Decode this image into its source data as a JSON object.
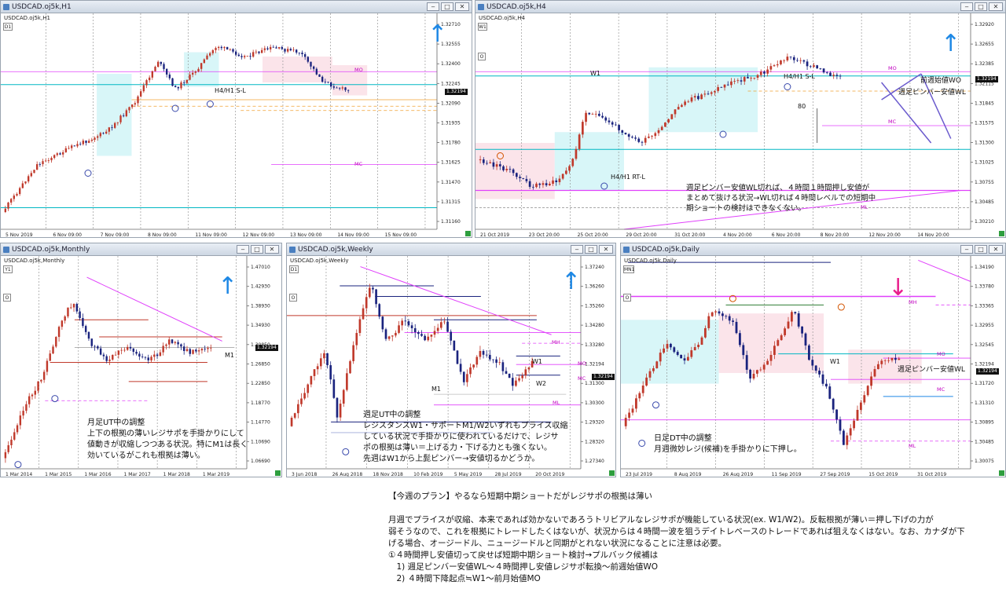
{
  "windows": {
    "h1": {
      "title": "USDCAD.oj5k,H1",
      "label": "USDCAD.oj5k,H1",
      "tf": "D1",
      "price_tag": "1.32194",
      "y_ticks": [
        "1.32710",
        "1.32555",
        "1.32400",
        "1.32245",
        "1.32090",
        "1.31935",
        "1.31780",
        "1.31625",
        "1.31470",
        "1.31315",
        "1.31160"
      ],
      "x_ticks": [
        "5 Nov 2019",
        "6 Nov 09:00",
        "7 Nov 09:00",
        "8 Nov 09:00",
        "11 Nov 09:00",
        "12 Nov 09:00",
        "13 Nov 09:00",
        "14 Nov 09:00",
        "15 Nov 09:00"
      ],
      "ann": {
        "sl": "H4/H1 S-L",
        "mo": "MO",
        "mc": "MC"
      }
    },
    "h4": {
      "title": "USDCAD.oj5k,H4",
      "label": "USDCAD.oj5k,H4",
      "tf": "W1",
      "price_tag": "1.32194",
      "y_ticks": [
        "1.32920",
        "1.32655",
        "1.32385",
        "1.32115",
        "1.31845",
        "1.31575",
        "1.31300",
        "1.31025",
        "1.30755",
        "1.30485",
        "1.30210"
      ],
      "x_ticks": [
        "21 Oct 2019",
        "23 Oct 20:00",
        "25 Oct 20:00",
        "29 Oct 20:00",
        "31 Oct 20:00",
        "4 Nov 20:00",
        "6 Nov 20:00",
        "8 Nov 20:00",
        "12 Nov 20:00",
        "14 Nov 20:00"
      ],
      "ann": {
        "w1": "W1",
        "sl": "H4/H1 S-L",
        "rtl": "H4/H1 RT-L",
        "mo": "MO",
        "mc": "MC",
        "ml": "ML",
        "n80": "80",
        "prev_wo": "前週始値WO",
        "pinbar": "週足ピンバー安値WL"
      },
      "note": [
        "週足ピンバー安値WL切れば、４時間１時間押し安値が",
        "まとめて抜ける状況→WL切れば４時間レベルでの短期中",
        "期ショートの検討はできなくない。"
      ]
    },
    "monthly": {
      "title": "USDCAD.oj5k,Monthly",
      "label": "USDCAD.oj5k,Monthly",
      "tf": "Y1",
      "price_tag": "1.32194",
      "y_ticks": [
        "1.47010",
        "1.42930",
        "1.38930",
        "1.34930",
        "1.30850",
        "1.26850",
        "1.22850",
        "1.18770",
        "1.14770",
        "1.10690",
        "1.06690"
      ],
      "x_ticks": [
        "1 Mar 2014",
        "1 Mar 2015",
        "1 Mar 2016",
        "1 Mar 2017",
        "1 Mar 2018",
        "1 Mar 2019"
      ],
      "ann": {
        "m1": "M1"
      },
      "note": [
        "月足UT中の調整",
        "上下の根拠の薄いレジサポを手掛かりにして",
        "値動きが収縮しつつある状況。特にM1は長く",
        "効いているがこれも根拠は薄い。"
      ]
    },
    "weekly": {
      "title": "USDCAD.oj5k,Weekly",
      "label": "USDCAD.oj5k,Weekly",
      "tf": "D1",
      "price_tag": "1.32194",
      "y_ticks": [
        "1.37240",
        "1.36260",
        "1.35260",
        "1.34280",
        "1.33280",
        "1.32194",
        "1.31300",
        "1.30300",
        "1.29320",
        "1.28320",
        "1.27340"
      ],
      "x_ticks": [
        "3 Jun 2018",
        "26 Aug 2018",
        "18 Nov 2018",
        "10 Feb 2019",
        "5 May 2019",
        "28 Jul 2019",
        "20 Oct 2019"
      ],
      "ann": {
        "m1": "M1",
        "w1": "W1",
        "w2": "W2",
        "mh": "MH",
        "mo": "MO",
        "mc": "MC",
        "ml": "ML"
      },
      "note": [
        "週足UT中の調整",
        "レジスタンスW1・サポートM1/W2いずれもプライス収縮",
        "している状況で手掛かりに使われているだけで、レジサ",
        "ポの根拠は薄い＝上げる力・下げる力とも強くない。",
        "先週はW1から上髭ピンバー→安値切るかどうか。"
      ]
    },
    "daily": {
      "title": "USDCAD.oj5k,Daily",
      "label": "USDCAD.oj5k,Daily",
      "tf": "MN1",
      "price_tag": "1.32194",
      "y_ticks": [
        "1.34190",
        "1.33780",
        "1.33365",
        "1.32955",
        "1.32545",
        "1.32194",
        "1.31720",
        "1.31310",
        "1.30895",
        "1.30485",
        "1.30075"
      ],
      "x_ticks": [
        "23 Jul 2019",
        "8 Aug 2019",
        "26 Aug 2019",
        "11 Sep 2019",
        "27 Sep 2019",
        "15 Oct 2019",
        "31 Oct 2019"
      ],
      "ann": {
        "w1": "W1",
        "mh": "MH",
        "mo": "MO",
        "mc": "MC",
        "ml": "ML",
        "pinbar": "週足ピンバー安値WL"
      },
      "note": [
        "日足DT中の調整",
        "月週微妙レジ(候補)を手掛かりに下押し。"
      ]
    }
  },
  "bottom_text": [
    "【今週のプラン】やるなら短期中期ショートだがレジサポの根拠は薄い",
    "",
    "月週でプライスが収縮、本来であれば効かないであろうトリビアルなレジサポが機能している状況(ex. W1/W2)。反転根拠が薄い＝押し下げの力が",
    "弱そうなので、これを根拠にトレードしたくはないが、状況からは４時間一波を狙うデイトレベースのトレードであれば狙えなくはない。なお、カナダが下",
    "げる場合、オージードル、ニュージードルと同期がとれない状況になることに注意は必要。",
    "①４時間押し安値切って戻せば短期中期ショート検討→プルバック候補は",
    "　1) 週足ピンバー安値WL～４時間押し安値レジサポ転換～前週始値WO",
    "　2) ４時間下降起点≒W1～前月始値MO"
  ],
  "colors": {
    "bull": "#c0392b",
    "bear": "#1a237e",
    "cyan": "#00b7c3",
    "magenta": "#e040fb",
    "orange": "#f0a030",
    "blue_arrow": "#1e88e5",
    "pink_arrow": "#e91e8c"
  }
}
